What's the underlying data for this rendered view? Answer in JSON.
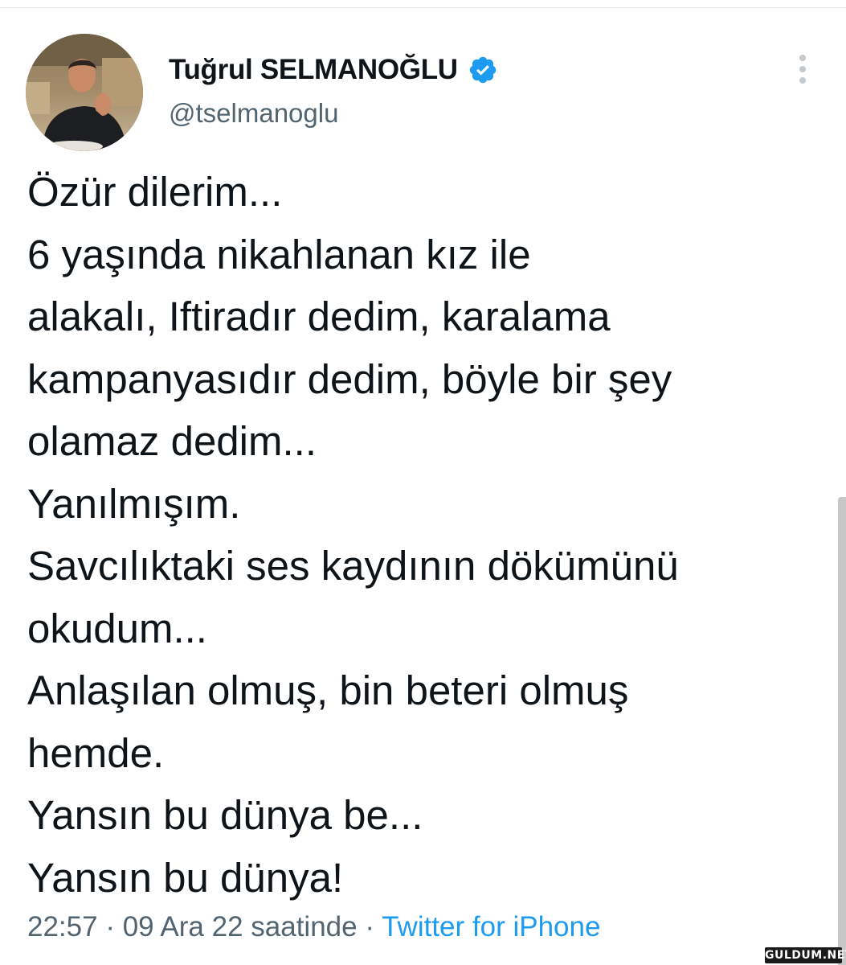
{
  "author": {
    "display_name": "Tuğrul SELMANOĞLU",
    "handle": "@tselmanoglu",
    "verified": true,
    "verified_icon": "verified-badge-icon",
    "verified_color": "#1d9bf0"
  },
  "tweet": {
    "lines": [
      "Özür dilerim...",
      "6 yaşında nikahlanan kız ile",
      "alakalı, Iftiradır dedim, karalama",
      "kampanyasıdır dedim, böyle bir şey",
      "olamaz dedim...",
      "Yanılmışım.",
      "Savcılıktaki ses kaydının dökümünü",
      "okudum...",
      "Anlaşılan olmuş, bin beteri olmuş",
      "hemde.",
      "Yansın bu dünya be...",
      "Yansın bu dünya!"
    ]
  },
  "meta": {
    "time": "22:57",
    "separator": " · ",
    "date": "09 Ara 22 saatinde",
    "source": "Twitter for iPhone",
    "source_color": "#1d9bf0"
  },
  "icons": {
    "more": "more-options-icon",
    "avatar": "avatar"
  },
  "watermark": {
    "text": "GULDUM.NET"
  }
}
